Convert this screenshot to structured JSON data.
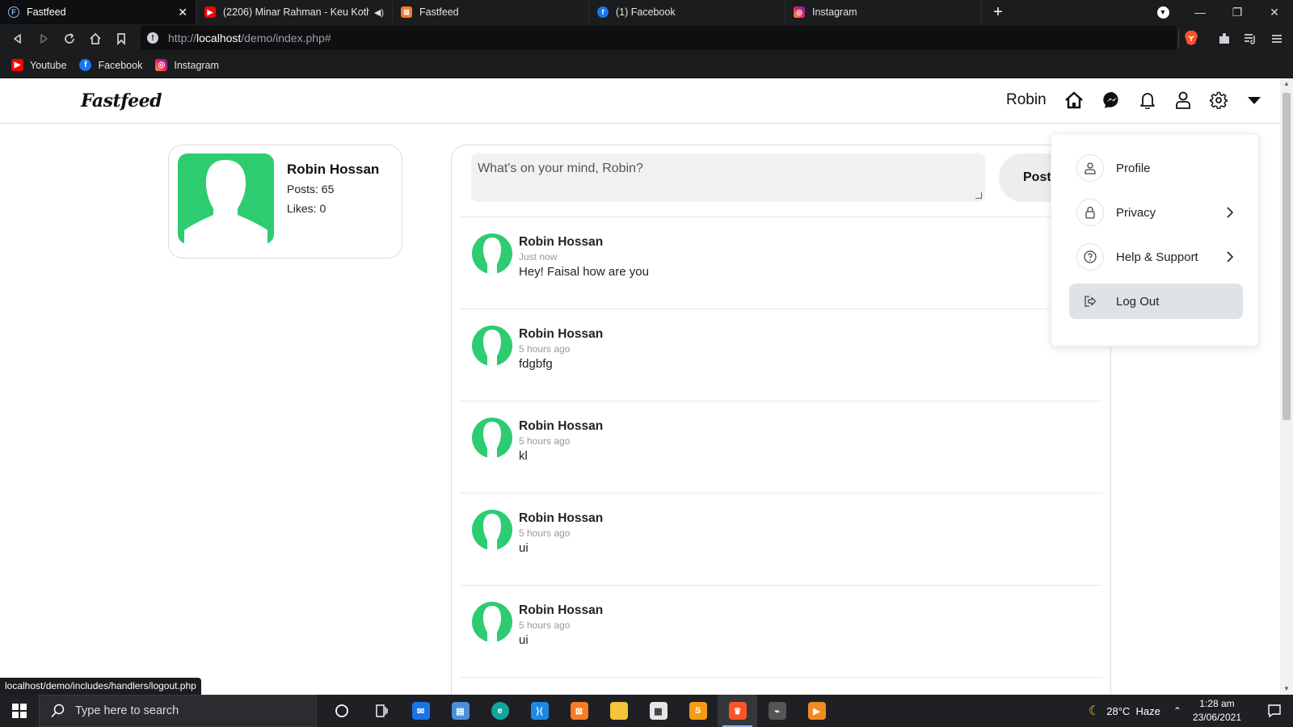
{
  "browser": {
    "tabs": [
      {
        "title": "Fastfeed",
        "icon": "fastfeed-favicon",
        "active": true
      },
      {
        "title": "(2206) Minar Rahman - Keu Kotha",
        "icon": "youtube-favicon",
        "active": false
      },
      {
        "title": "Fastfeed",
        "icon": "xampp-favicon",
        "active": false
      },
      {
        "title": "(1) Facebook",
        "icon": "facebook-favicon",
        "active": false
      },
      {
        "title": "Instagram",
        "icon": "instagram-favicon",
        "active": false
      }
    ],
    "url_prefix": "http://",
    "url_host": "localhost",
    "url_path": "/demo/index.php#",
    "bookmarks": [
      {
        "label": "Youtube",
        "icon": "youtube-icon"
      },
      {
        "label": "Facebook",
        "icon": "facebook-icon"
      },
      {
        "label": "Instagram",
        "icon": "instagram-icon"
      }
    ],
    "status_url": "localhost/demo/includes/handlers/logout.php"
  },
  "app": {
    "logo": "Fastfeed",
    "nav_user": "Robin",
    "nav_icons": [
      "home-icon",
      "messenger-icon",
      "bell-icon",
      "user-icon",
      "gear-icon",
      "caret-down-icon"
    ],
    "colors": {
      "avatar_green": "#2ecc71",
      "hover_gray": "#dfe3e8"
    }
  },
  "profile": {
    "name": "Robin Hossan",
    "posts": "Posts: 65",
    "likes": "Likes: 0"
  },
  "composer": {
    "placeholder": "What's on your mind, Robin?",
    "post_label": "Post"
  },
  "posts": [
    {
      "author": "Robin Hossan",
      "time": "Just now",
      "text": "Hey! Faisal how are you"
    },
    {
      "author": "Robin Hossan",
      "time": "5 hours ago",
      "text": "fdgbfg"
    },
    {
      "author": "Robin Hossan",
      "time": "5 hours ago",
      "text": "kl"
    },
    {
      "author": "Robin Hossan",
      "time": "5 hours ago",
      "text": "ui"
    },
    {
      "author": "Robin Hossan",
      "time": "5 hours ago",
      "text": "ui"
    }
  ],
  "dropdown": {
    "items": [
      {
        "label": "Profile",
        "icon": "user-icon",
        "chevron": false
      },
      {
        "label": "Privacy",
        "icon": "lock-icon",
        "chevron": true
      },
      {
        "label": "Help & Support",
        "icon": "help-icon",
        "chevron": true
      },
      {
        "label": "Log Out",
        "icon": "logout-icon",
        "chevron": false,
        "hovered": true
      }
    ]
  },
  "taskbar": {
    "search_placeholder": "Type here to search",
    "weather": "28°C  Haze",
    "time": "1:28 am",
    "date": "23/06/2021"
  }
}
